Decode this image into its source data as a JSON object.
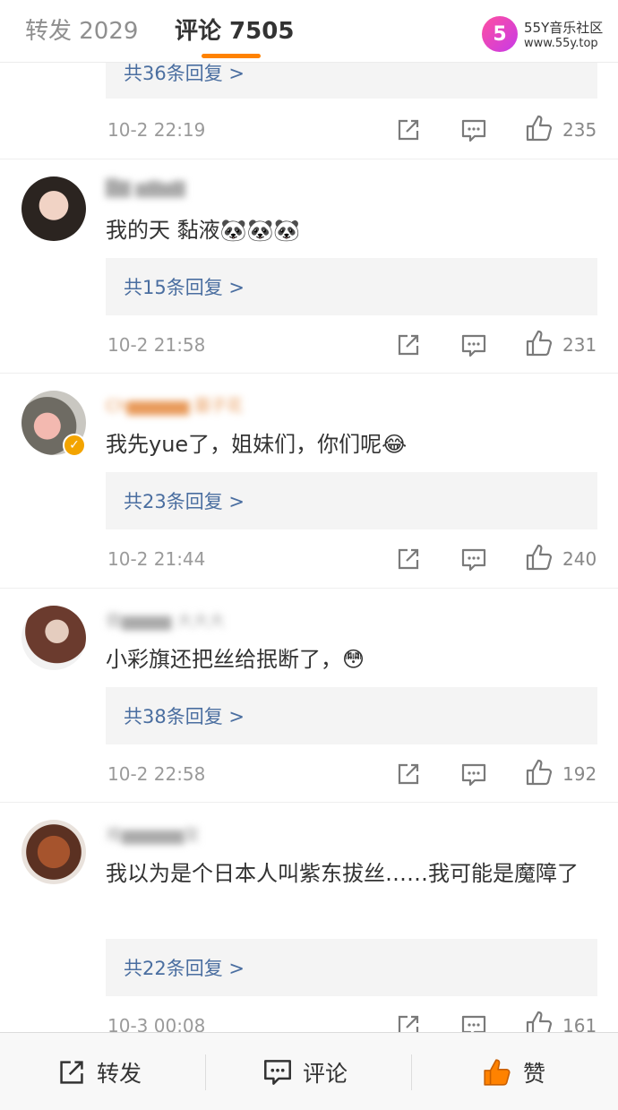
{
  "header": {
    "tab_repost": "转发 2029",
    "tab_comments": "评论 7505",
    "watermark_title": "55Y音乐社区",
    "watermark_url": "www.55y.top",
    "watermark_logo": "5"
  },
  "comments": [
    {
      "replies": "共36条回复 >",
      "time": "10-2 22:19",
      "likes": "235"
    },
    {
      "username": "█▇ ▆▇▆▇",
      "text": "我的天 黏液🐼🐼🐼",
      "replies": "共15条回复 >",
      "time": "10-2 21:58",
      "likes": "231"
    },
    {
      "username": "Ch▆▆▆▆▆ 菌子花",
      "text": "我先yue了，姐妹们，你们呢😂",
      "replies": "共23条回复 >",
      "time": "10-2 21:44",
      "likes": "240"
    },
    {
      "username": "傲▆▆▆▆ 大大大",
      "text": "小彩旗还把丝给抿断了，😳",
      "replies": "共38条回复 >",
      "time": "10-2 22:58",
      "likes": "192"
    },
    {
      "username": "难▆▆▆▆▆复",
      "text": "我以为是个日本人叫紫东拔丝……我可能是魔障了",
      "replies": "共22条回复 >",
      "time": "10-3 00:08",
      "likes": "161"
    }
  ],
  "bottom_bar": {
    "repost": "转发",
    "comment": "评论",
    "like": "赞"
  },
  "colors": {
    "accent": "#ff8200",
    "link": "#4a6ea0",
    "like_active": "#ff8200"
  },
  "icons": [
    "share-icon",
    "comment-icon",
    "thumbs-up-icon",
    "verified-badge-icon"
  ]
}
